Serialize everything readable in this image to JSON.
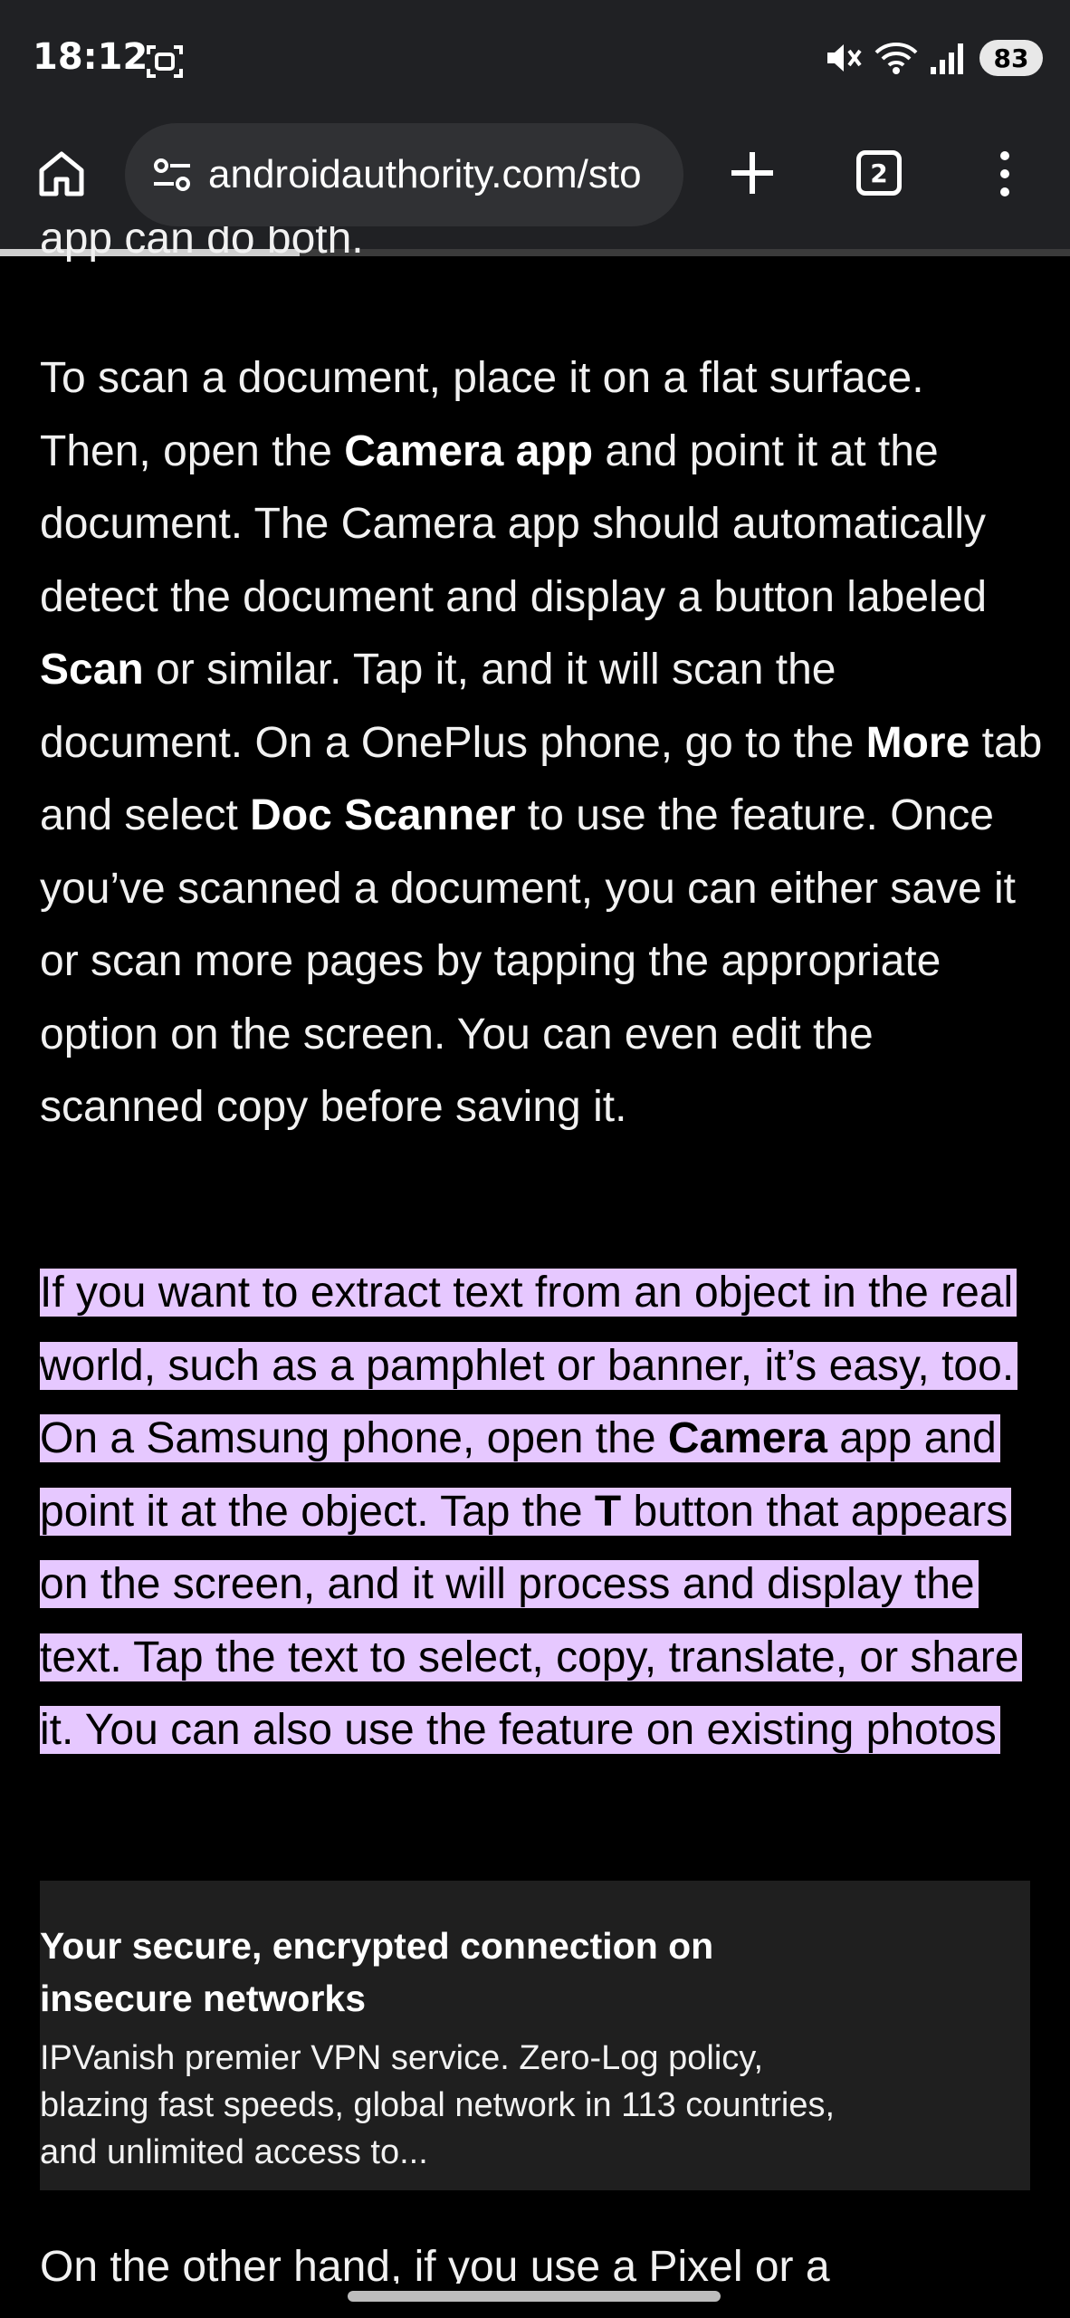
{
  "status_bar": {
    "time": "18:12",
    "battery": "83",
    "icons": [
      "screenshot-icon",
      "mute-icon",
      "wifi-icon",
      "signal-icon",
      "battery-icon"
    ]
  },
  "toolbar": {
    "url": "androidauthority.com/sto",
    "tab_count": "2",
    "page_progress": 0.28,
    "icons": [
      "home-icon",
      "site-settings-icon",
      "new-tab-icon",
      "tabs-icon",
      "more-menu-icon"
    ]
  },
  "article": {
    "partial_top": "app can do both.",
    "p1": {
      "t1": "To scan a document, place it on a flat surface. Then, open the ",
      "b1": "Camera app",
      "t2": " and point it at the document. The Camera app should automatically detect the document and display a button labeled ",
      "b2": "Scan",
      "t3": " or similar. Tap it, and it will scan the document. On a OnePlus phone, go to the ",
      "b3": "More",
      "t4": " tab and select ",
      "b4": "Doc Scanner",
      "t5": " to use the feature. Once you’ve scanned a document, you can either save it or scan more pages by tapping the appropriate option on the screen. You can even edit the scanned copy before saving it."
    },
    "p2": {
      "t1": "If you want to extract text from an object in the real world, such as a pamphlet or banner, it’s easy, too. On a Samsung phone, open the ",
      "b1": "Camera",
      "t2": " app and point it at the object. Tap the ",
      "b2": "T",
      "t3": " button that appears on the screen, and it will process and display the text. Tap the text to select, copy, translate, or share it. You can also use the feature on existing photos"
    },
    "highlight_color": "#e6c8ff",
    "partial_bottom": "On the other hand, if you use a Pixel or a"
  },
  "ad": {
    "title": "Your secure, encrypted connection on insecure networks",
    "body": "IPVanish premier VPN service. Zero-Log policy, blazing fast speeds, global network in 113 countries, and unlimited access to..."
  }
}
